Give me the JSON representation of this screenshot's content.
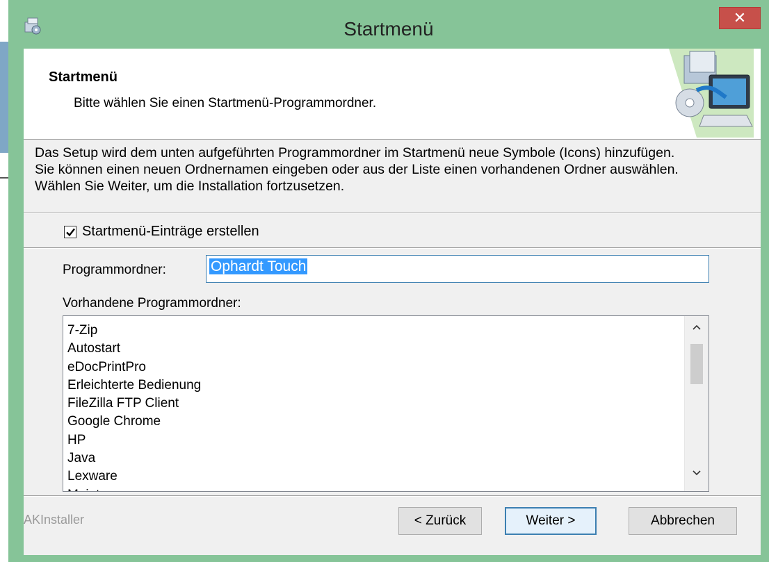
{
  "window": {
    "title": "Startmenü",
    "close_label": "✕"
  },
  "header": {
    "title": "Startmenü",
    "subtitle": "Bitte wählen Sie einen Startmenü-Programmordner."
  },
  "description": {
    "line1": "Das Setup wird dem unten aufgeführten Programmordner im Startmenü neue Symbole (Icons) hinzufügen.",
    "line2": "Sie können einen neuen Ordnernamen eingeben oder aus der Liste einen vorhandenen Ordner auswählen.",
    "line3": "Wählen Sie Weiter, um die Installation fortzusetzen."
  },
  "create_entries": {
    "label": "Startmenü-Einträge erstellen",
    "checked": true
  },
  "program_folder": {
    "label": "Programmordner:",
    "value": "Ophardt Touch"
  },
  "existing": {
    "label": "Vorhandene Programmordner:",
    "items": [
      "7-Zip",
      "Autostart",
      "eDocPrintPro",
      "Erleichterte Bedienung",
      "FileZilla FTP Client",
      "Google Chrome",
      "HP",
      "Java",
      "Lexware",
      "Maintenance"
    ]
  },
  "footer": {
    "brand": "AKInstaller",
    "back_label": "< Zurück",
    "next_label": "Weiter >",
    "cancel_label": "Abbrechen"
  },
  "colors": {
    "frame": "#86c498",
    "close": "#c7504a",
    "selection": "#3399ff"
  }
}
